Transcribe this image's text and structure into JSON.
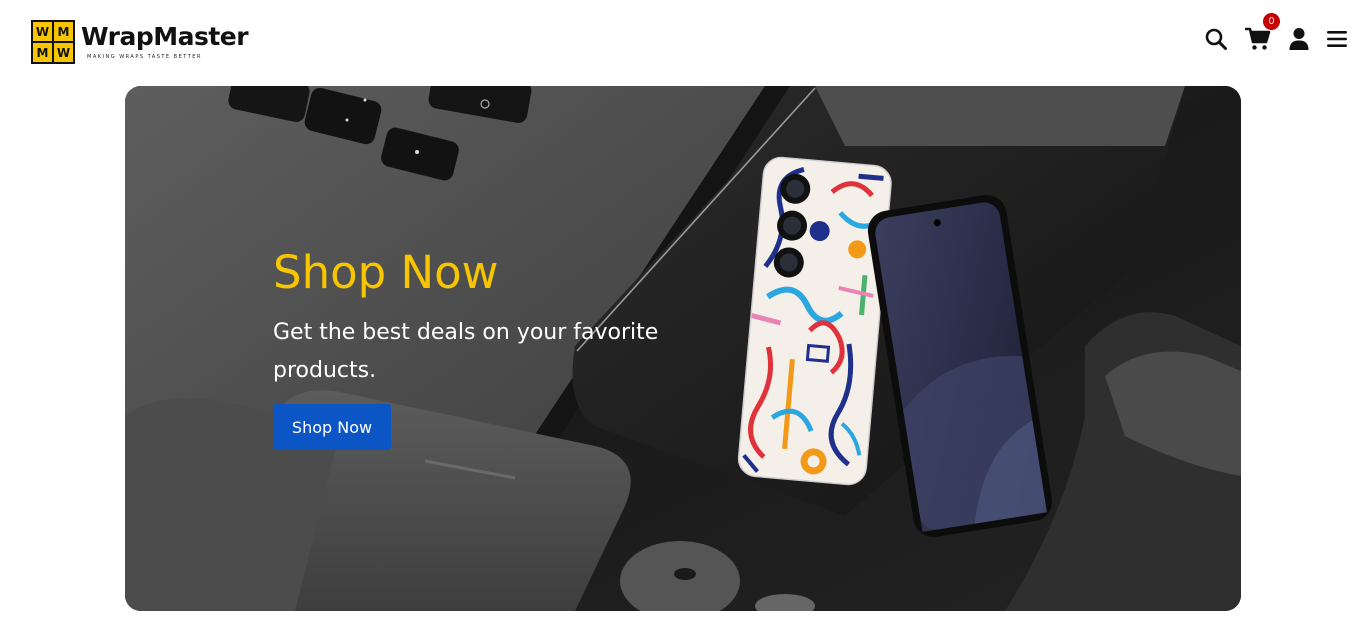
{
  "brand": {
    "logo_letters": [
      "W",
      "M",
      "M",
      "W"
    ],
    "name": "WrapMaster",
    "tagline": "MAKING WRAPS TASTE BETTER"
  },
  "header": {
    "icons": [
      "search-icon",
      "cart-icon",
      "user-icon",
      "menu-icon"
    ],
    "cart_count": "0"
  },
  "hero": {
    "title": "Shop Now",
    "subtitle": "Get the best deals on your favorite products.",
    "button_label": "Shop Now"
  },
  "colors": {
    "accent_yellow": "#f7c600",
    "button_blue": "#0b56c4",
    "badge_red": "#c40000",
    "hero_dark": "#1c1c1c"
  }
}
